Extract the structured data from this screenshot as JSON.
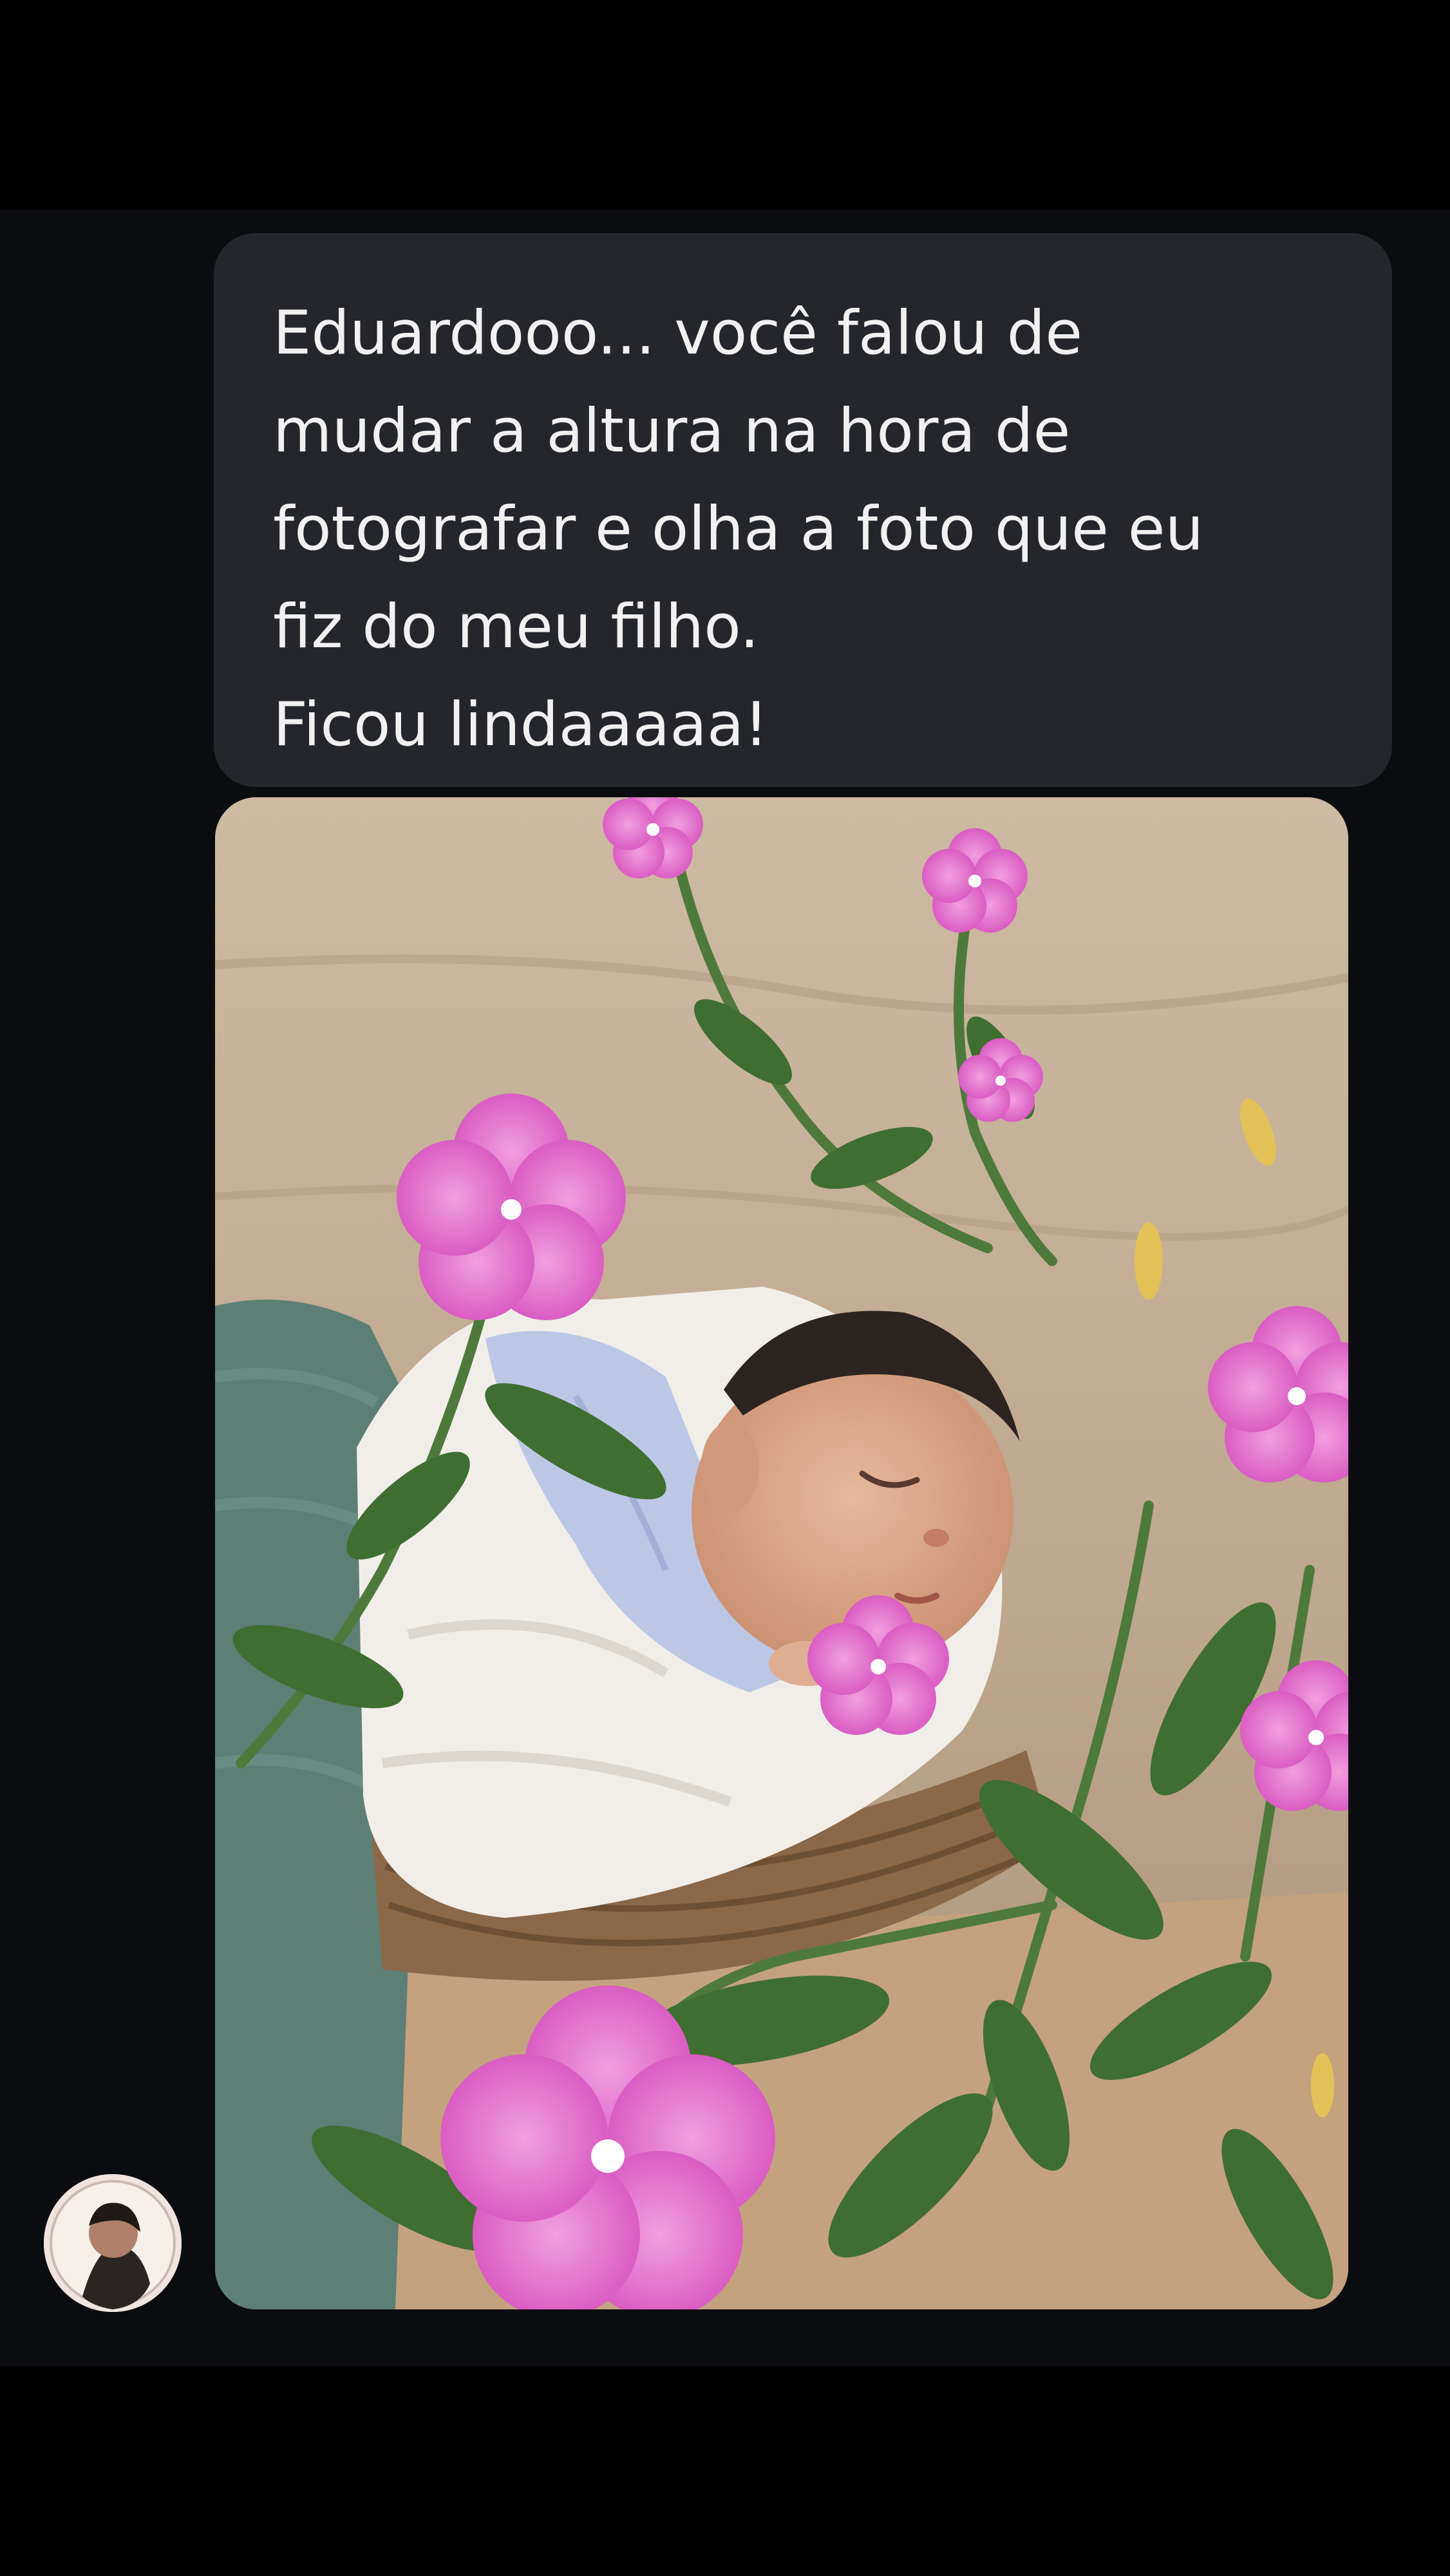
{
  "conversation": {
    "message": {
      "text": "Eduardooo... você falou de\nmudar a altura na hora de\nfotografar e olha a foto que eu\nfiz do meu filho.\nFicou lindaaaaa!"
    },
    "attachment": {
      "kind": "photo",
      "subject_icon": "photo-newborn-flowers"
    },
    "sender": {
      "avatar_icon": "avatar-profile-photo"
    }
  },
  "colors": {
    "page_background": "#000000",
    "chat_background": "#0b0c0f",
    "bubble_background": "#24262c",
    "bubble_text": "#f1f1f1"
  }
}
